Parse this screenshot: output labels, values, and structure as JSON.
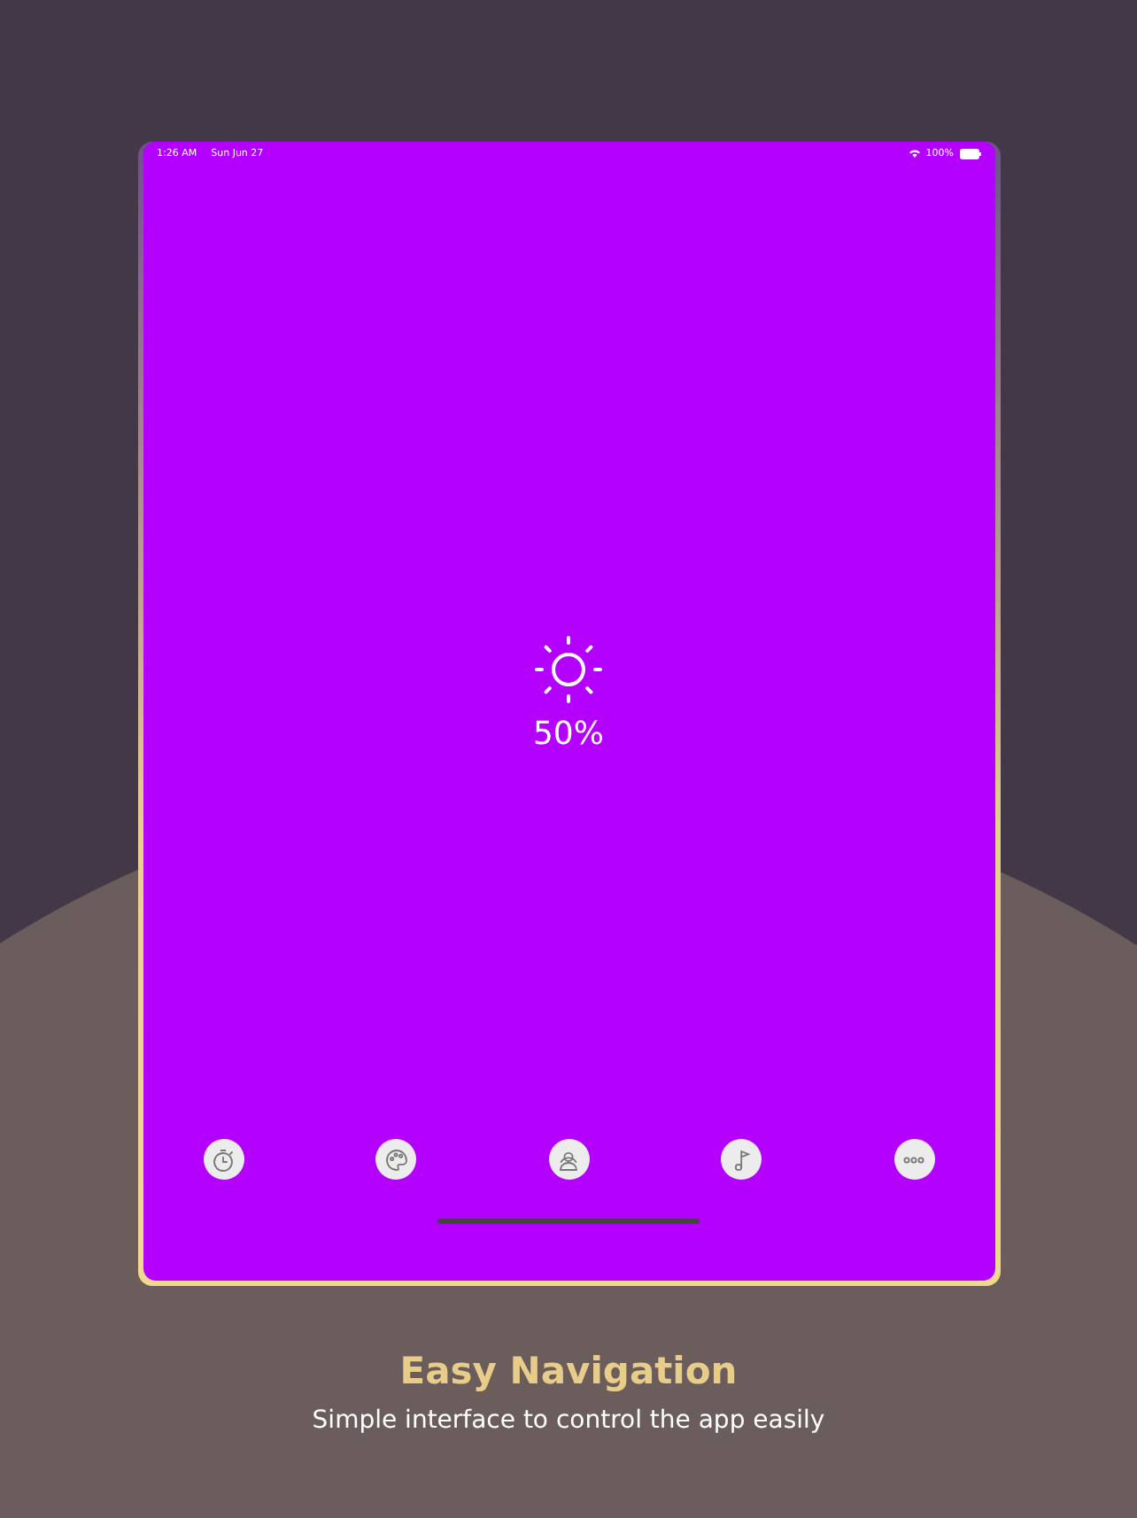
{
  "status_bar": {
    "time": "1:26 AM",
    "date": "Sun Jun 27",
    "battery": "100%"
  },
  "brightness": {
    "reading": "50%"
  },
  "nav_buttons": [
    {
      "kind": "timer"
    },
    {
      "kind": "palette"
    },
    {
      "kind": "person"
    },
    {
      "kind": "music"
    },
    {
      "kind": "more"
    }
  ],
  "caption": {
    "title": "Easy Navigation",
    "subtitle": "Simple interface to control the app easily"
  }
}
